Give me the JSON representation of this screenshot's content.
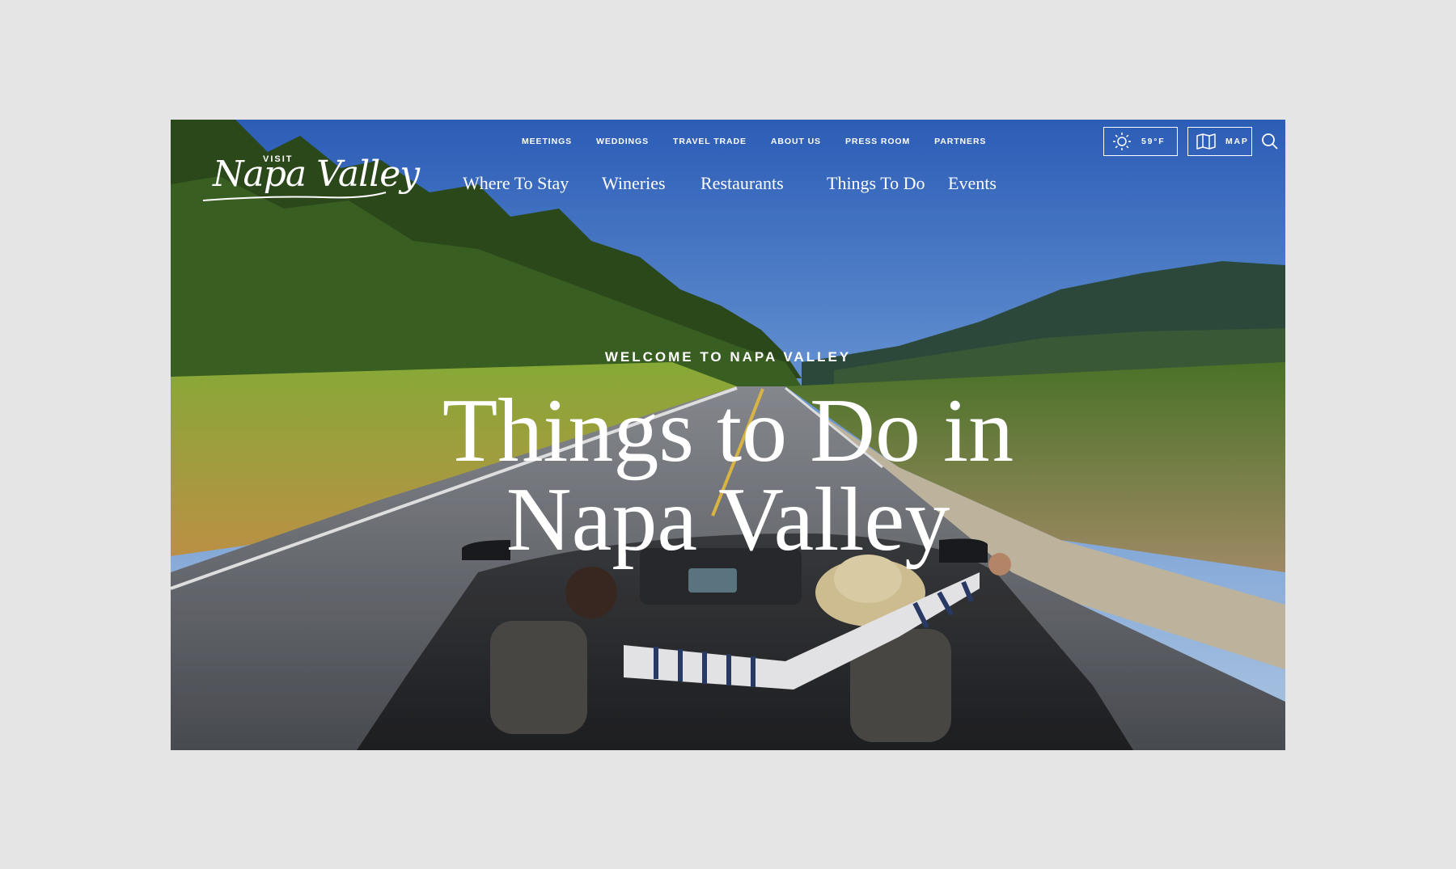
{
  "brand": {
    "visit": "VISIT",
    "name": "Napa Valley"
  },
  "utility_nav": [
    "MEETINGS",
    "WEDDINGS",
    "TRAVEL TRADE",
    "ABOUT US",
    "PRESS ROOM",
    "PARTNERS"
  ],
  "main_nav": [
    "Where To Stay",
    "Wineries",
    "Restaurants",
    "Things To Do",
    "Events"
  ],
  "weather": {
    "temp": "59°F",
    "icon": "sun-icon"
  },
  "map": {
    "label": "MAP",
    "icon": "map-icon"
  },
  "search": {
    "icon": "search-icon"
  },
  "hero": {
    "eyebrow": "WELCOME TO NAPA VALLEY",
    "headline_line1": "Things to Do in",
    "headline_line2": "Napa Valley"
  },
  "colors": {
    "page_bg": "#e5e5e5",
    "sky": "#3b6fc9",
    "text": "#ffffff"
  }
}
